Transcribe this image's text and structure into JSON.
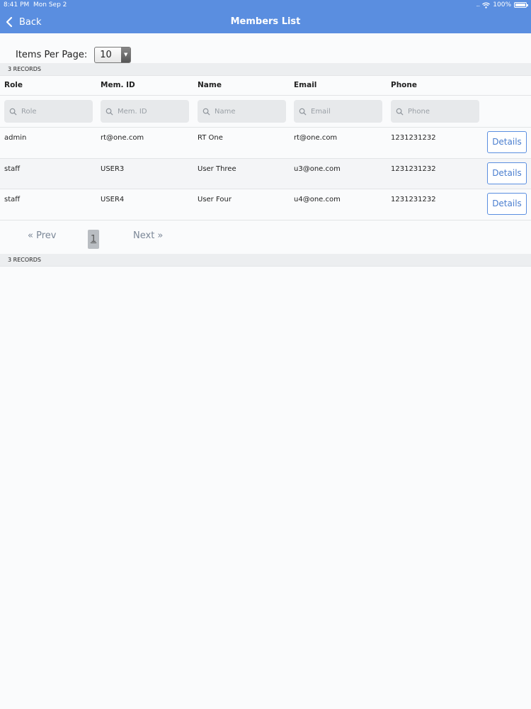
{
  "status_bar": {
    "time": "8:41 PM",
    "date": "Mon Sep 2",
    "battery": "100%",
    "battery_level": 1.0
  },
  "nav": {
    "back_label": "Back",
    "title": "Members List"
  },
  "items_per_page": {
    "label": "Items Per Page:",
    "value": "10"
  },
  "records_label": "3 RECORDS",
  "columns": [
    "Role",
    "Mem. ID",
    "Name",
    "Email",
    "Phone"
  ],
  "filters": {
    "role": "Role",
    "mem_id": "Mem. ID",
    "name": "Name",
    "email": "Email",
    "phone": "Phone"
  },
  "rows": [
    {
      "role": "admin",
      "mem_id": "rt@one.com",
      "name": "RT One",
      "email": "rt@one.com",
      "phone": "1231231232",
      "action": "Details"
    },
    {
      "role": "staff",
      "mem_id": "USER3",
      "name": "User Three",
      "email": "u3@one.com",
      "phone": "1231231232",
      "action": "Details"
    },
    {
      "role": "staff",
      "mem_id": "USER4",
      "name": "User Four",
      "email": "u4@one.com",
      "phone": "1231231232",
      "action": "Details"
    }
  ],
  "pagination": {
    "prev": "« Prev",
    "current": "1",
    "next": "Next »"
  },
  "colors": {
    "accent": "#5a8ee0",
    "button_text": "#4a7ecf"
  }
}
